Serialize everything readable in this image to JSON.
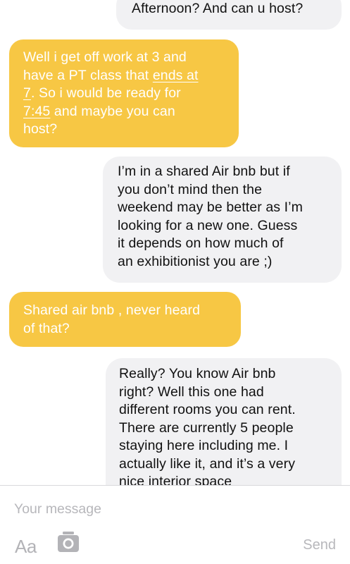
{
  "messages": [
    {
      "sender": "mine",
      "lines": [
        "Afternoon? And can u host?"
      ]
    },
    {
      "sender": "theirs",
      "lines": [
        "Well i get off work at 3 and",
        "have a PT class that ends at",
        "7. So i would be ready for",
        "7:45 and maybe you can",
        "host?"
      ]
    },
    {
      "sender": "mine",
      "lines": [
        "I’m in a shared Air bnb but if",
        "you don’t mind then the",
        "weekend may be better as I’m",
        "looking for a new one. Guess",
        "it depends on how much of",
        "an exhibitionist you are ;)"
      ]
    },
    {
      "sender": "theirs",
      "lines": [
        "Shared air bnb , never heard",
        "of that?"
      ]
    },
    {
      "sender": "mine",
      "lines": [
        "Really? You know Air bnb",
        "right? Well this one had",
        "different rooms you can rent.",
        "There are currently 5 people",
        "staying here including me. I",
        "actually like it, and it’s a very",
        "nice interior space"
      ]
    }
  ],
  "links": {
    "ends_at_7_part1": "ends at",
    "ends_at_7_part2": "7",
    "time_745": "7:45"
  },
  "composer": {
    "placeholder": "Your message",
    "font_button_label": "Aa",
    "send_label": "Send"
  },
  "colors": {
    "theirs_bubble": "#f7c744",
    "mine_bubble": "#f1f1f3",
    "muted": "#b7b7bb"
  }
}
